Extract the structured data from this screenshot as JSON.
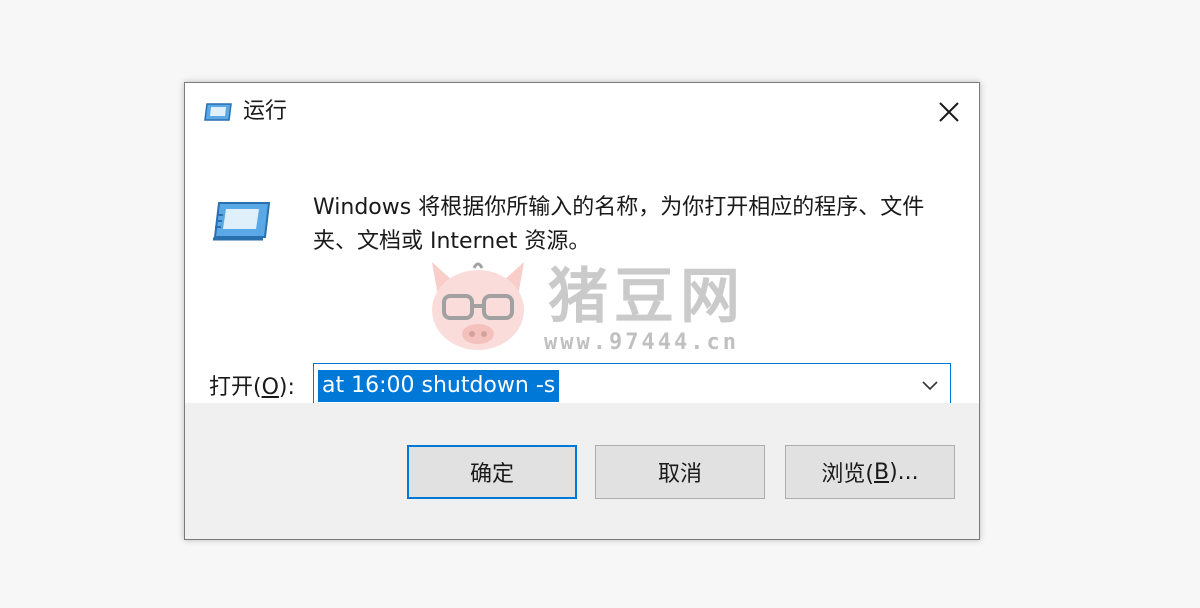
{
  "window": {
    "title": "运行",
    "close_icon": "close-icon"
  },
  "body": {
    "description": "Windows 将根据你所输入的名称，为你打开相应的程序、文件夹、文档或 Internet 资源。",
    "open_label_prefix": "打开(",
    "open_label_accel": "O",
    "open_label_suffix": "):",
    "command_value": "at 16:00 shutdown -s"
  },
  "buttons": {
    "ok_label": "确定",
    "cancel_label": "取消",
    "browse_prefix": "浏览(",
    "browse_accel": "B",
    "browse_suffix": ")..."
  },
  "watermark": {
    "brand": "猪豆网",
    "url": "www.97444.cn"
  },
  "colors": {
    "accent": "#0078d7",
    "footer_bg": "#f0f0f0",
    "button_bg": "#e1e1e1"
  }
}
